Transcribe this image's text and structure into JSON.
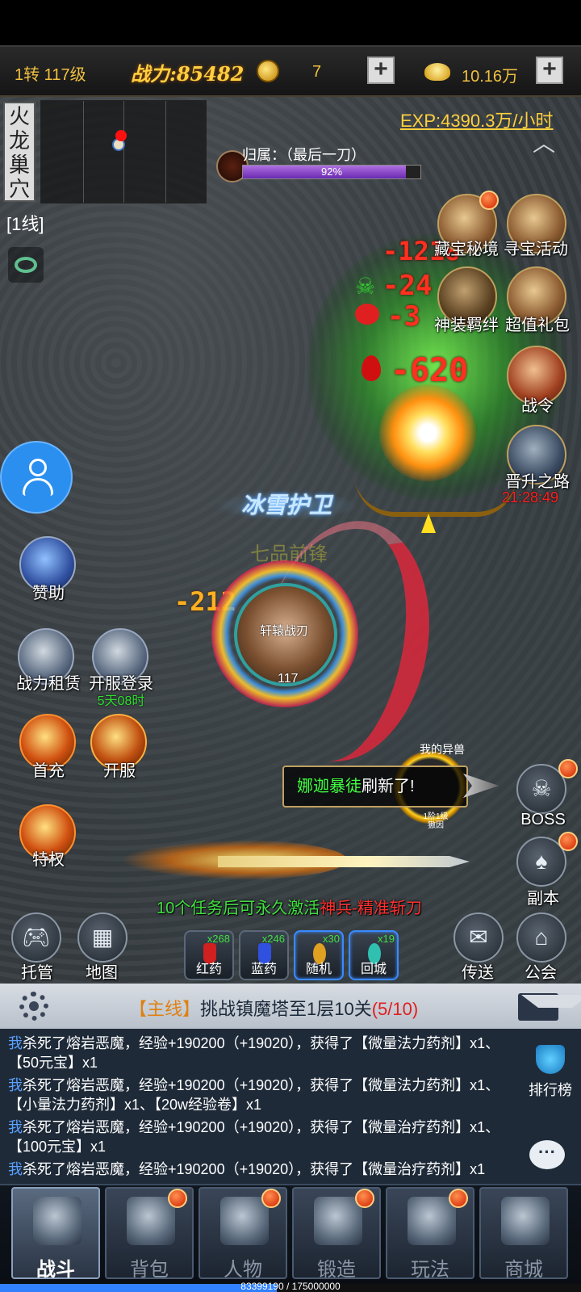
{
  "top_bar": {
    "level": "1转 117级",
    "power": "战力:85482",
    "coins": "7",
    "gold": "10.16万",
    "plus": "+"
  },
  "map": {
    "name": "火龙巢穴",
    "line": "[1线]"
  },
  "exp_rate": "EXP:4390.3万/小时",
  "boss": {
    "owner_label": "归属：（最后一刀）",
    "hp_percent_text": "92%",
    "hp_fraction": 0.92
  },
  "damage_numbers": [
    "-1218",
    "-24",
    "-3",
    "-620",
    "-212"
  ],
  "right_activities": [
    {
      "label": "藏宝秘境"
    },
    {
      "label": "寻宝活动"
    },
    {
      "label": "神装羁绊"
    },
    {
      "label": "超值礼包"
    },
    {
      "label": "战令"
    },
    {
      "label": "晋升之路",
      "timer": "21:28:49"
    }
  ],
  "left_buttons": {
    "sponsor": "赞助",
    "power_rent": "战力租赁",
    "open_login": "开服登录",
    "open_login_timer": "5天08时",
    "first_charge": "首充",
    "open_server": "开服",
    "privilege": "特权"
  },
  "player": {
    "guard_title": "冰雪护卫",
    "rank_title": "七品前锋",
    "name": "轩辕战刃",
    "level": "117"
  },
  "beast": {
    "label": "我的异兽",
    "sub": "1阶1级\n獓因"
  },
  "notice": {
    "name": "娜迦暴徒",
    "suffix": "刷新了!"
  },
  "right_buttons": {
    "boss": "BOSS",
    "dungeon": "副本",
    "teleport": "传送",
    "guild": "公会"
  },
  "quest_banner": {
    "part1": "10个任务后可永久激活",
    "part2": "神兵-精准斩刀"
  },
  "bottom_controls": {
    "auto": "托管",
    "map": "地图"
  },
  "potions": [
    {
      "name": "红药",
      "count": "x268",
      "color": "#d02020"
    },
    {
      "name": "蓝药",
      "count": "x246",
      "color": "#3050e0"
    },
    {
      "name": "随机",
      "count": "x30",
      "color": "#e0a020"
    },
    {
      "name": "回城",
      "count": "x19",
      "color": "#30c0b0"
    }
  ],
  "main_quest": {
    "tag": "【主线】",
    "text": "挑战镇魔塔至1层10关",
    "progress": "(5/10)"
  },
  "chat": [
    {
      "who": "我",
      "text": "杀死了熔岩恶魔，经验+190200（+19020），获得了【微量法力药剂】x1、【50元宝】x1"
    },
    {
      "who": "我",
      "text": "杀死了熔岩恶魔，经验+190200（+19020），获得了【微量法力药剂】x1、【小量法力药剂】x1、【20w经验卷】x1"
    },
    {
      "who": "我",
      "text": "杀死了熔岩恶魔，经验+190200（+19020），获得了【微量治疗药剂】x1、【100元宝】x1"
    },
    {
      "who": "我",
      "text": "杀死了熔岩恶魔，经验+190200（+19020），获得了【微量治疗药剂】x1"
    }
  ],
  "ranking": "排行榜",
  "nav": [
    {
      "label": "战斗",
      "active": true
    },
    {
      "label": "背包"
    },
    {
      "label": "人物"
    },
    {
      "label": "锻造"
    },
    {
      "label": "玩法"
    },
    {
      "label": "商城"
    }
  ],
  "exp_bar": {
    "text": "83399190 / 175000000",
    "fraction": 0.4766
  }
}
